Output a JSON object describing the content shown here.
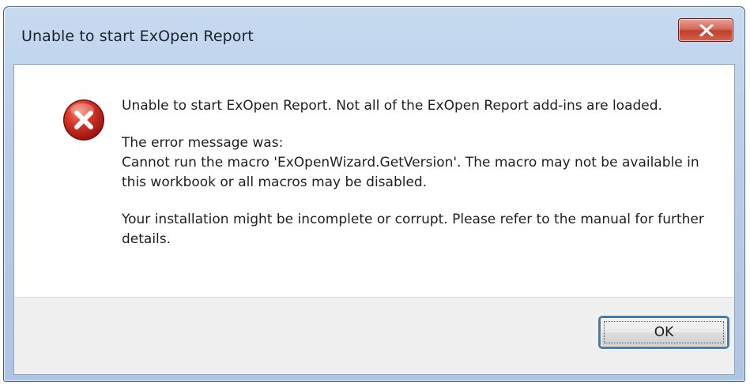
{
  "window": {
    "title": "Unable to start ExOpen Report",
    "close_icon": "close-icon"
  },
  "dialog": {
    "icon": "error-icon",
    "message_line1": "Unable to start ExOpen Report. Not all of the ExOpen Report add-ins are loaded.",
    "error_heading": "The error message was:",
    "error_detail": "Cannot run the macro 'ExOpenWizard.GetVersion'. The macro may not be available in this workbook or all macros may be disabled.",
    "advice": "Your installation might be incomplete or corrupt. Please refer to the manual for further details."
  },
  "buttons": {
    "ok_label": "OK"
  },
  "colors": {
    "title_bar": "#b7cde8",
    "close_button": "#c94a36",
    "error_icon": "#c8261b",
    "button_area": "#f0f0f0"
  }
}
